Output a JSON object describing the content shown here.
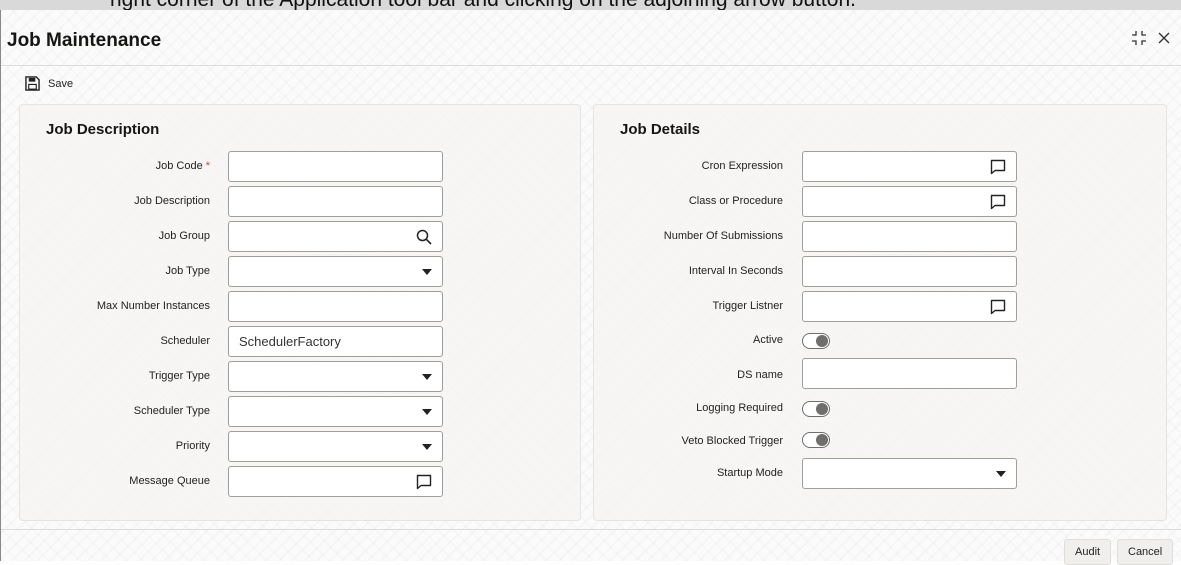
{
  "caption": "right corner of the Application tool bar and clicking on the adjoining arrow button.",
  "window": {
    "title": "Job Maintenance",
    "icons": [
      "collapse-icon",
      "close-icon"
    ]
  },
  "toolbar": {
    "save_label": "Save"
  },
  "job_description": {
    "title": "Job Description",
    "fields": {
      "job_code": {
        "label": "Job Code",
        "required_mark": "*",
        "value": ""
      },
      "job_description": {
        "label": "Job Description",
        "value": ""
      },
      "job_group": {
        "label": "Job Group",
        "value": "",
        "icon": "search-icon"
      },
      "job_type": {
        "label": "Job Type",
        "value": ""
      },
      "max_number_instances": {
        "label": "Max Number Instances",
        "value": ""
      },
      "scheduler": {
        "label": "Scheduler",
        "value": "SchedulerFactory"
      },
      "trigger_type": {
        "label": "Trigger Type",
        "value": ""
      },
      "scheduler_type": {
        "label": "Scheduler Type",
        "value": ""
      },
      "priority": {
        "label": "Priority",
        "value": ""
      },
      "message_queue": {
        "label": "Message Queue",
        "value": "",
        "icon": "comment-icon"
      }
    }
  },
  "job_details": {
    "title": "Job Details",
    "fields": {
      "cron_expression": {
        "label": "Cron Expression",
        "value": "",
        "icon": "comment-icon"
      },
      "class_or_procedure": {
        "label": "Class or Procedure",
        "value": "",
        "icon": "comment-icon"
      },
      "number_of_submissions": {
        "label": "Number Of Submissions",
        "value": ""
      },
      "interval_in_seconds": {
        "label": "Interval In Seconds",
        "value": ""
      },
      "trigger_listner": {
        "label": "Trigger Listner",
        "value": "",
        "icon": "comment-icon"
      },
      "active": {
        "label": "Active",
        "value": false
      },
      "ds_name": {
        "label": "DS name",
        "value": ""
      },
      "logging_required": {
        "label": "Logging Required",
        "value": false
      },
      "veto_blocked_trigger": {
        "label": "Veto Blocked Trigger",
        "value": false
      },
      "startup_mode": {
        "label": "Startup Mode",
        "value": ""
      }
    }
  },
  "footer": {
    "audit_label": "Audit",
    "cancel_label": "Cancel"
  }
}
